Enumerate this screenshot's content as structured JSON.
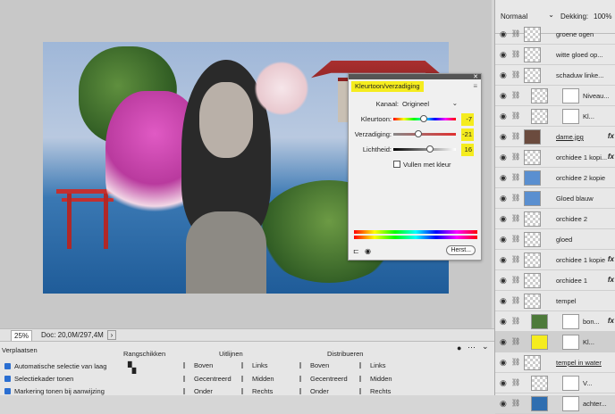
{
  "status": {
    "zoom": "25%",
    "doc": "Doc: 20,0M/297,4M"
  },
  "huesat": {
    "title": "Kleurtoon/verzadiging",
    "kanaal_label": "Kanaal:",
    "kanaal_value": "Origineel",
    "kleurtoon_label": "Kleurtoon:",
    "kleurtoon_value": "-7",
    "kleurtoon_level": 0.48,
    "verzadiging_label": "Verzadiging:",
    "verzadiging_value": "-21",
    "verzadiging_level": 0.4,
    "lichtheid_label": "Lichtheid:",
    "lichtheid_value": "16",
    "lichtheid_level": 0.58,
    "colorize_label": "Vullen met kleur",
    "reset_label": "Herst..."
  },
  "layers_panel": {
    "blend_mode": "Normaal",
    "opacity_label": "Dekking:",
    "opacity_value": "100%",
    "items": [
      {
        "name": "groene ogen",
        "fx": ""
      },
      {
        "name": "witte gloed op...",
        "fx": ""
      },
      {
        "name": "schaduw linke...",
        "fx": ""
      },
      {
        "name": "Niveau...",
        "fx": ""
      },
      {
        "name": "Kl...",
        "fx": ""
      },
      {
        "name": "dame.jpg",
        "fx": "fx"
      },
      {
        "name": "orchidee 1 kopi...",
        "fx": "fx"
      },
      {
        "name": "orchidee 2 kopie",
        "fx": ""
      },
      {
        "name": "Gloed blauw",
        "fx": ""
      },
      {
        "name": "orchidee 2",
        "fx": ""
      },
      {
        "name": "gloed",
        "fx": ""
      },
      {
        "name": "orchidee 1 kopie",
        "fx": "fx"
      },
      {
        "name": "orchidee 1",
        "fx": "fx"
      },
      {
        "name": "tempel",
        "fx": ""
      },
      {
        "name": "bon...",
        "fx": "fx"
      },
      {
        "name": "Kl...",
        "fx": ""
      },
      {
        "name": "tempel in water",
        "fx": ""
      },
      {
        "name": "V...",
        "fx": ""
      },
      {
        "name": "achter...",
        "fx": ""
      }
    ]
  },
  "options": {
    "tool": "Verplaatsen",
    "auto_select": "Automatische selectie van laag",
    "show_bbox": "Selectiekader tonen",
    "show_highlight": "Markering tonen bij aanwijzing",
    "arrange": "Rangschikken",
    "align_title": "Uitlijnen",
    "distribute_title": "Distribueren",
    "align": [
      "Boven",
      "Gecentreerd",
      "Onder",
      "Links",
      "Midden",
      "Rechts"
    ],
    "distribute": [
      "Boven",
      "Gecentreerd",
      "Onder",
      "Links",
      "Midden",
      "Rechts"
    ]
  },
  "colors": {
    "highlight": "#f5ec1e",
    "accent": "#2a6ed1"
  }
}
